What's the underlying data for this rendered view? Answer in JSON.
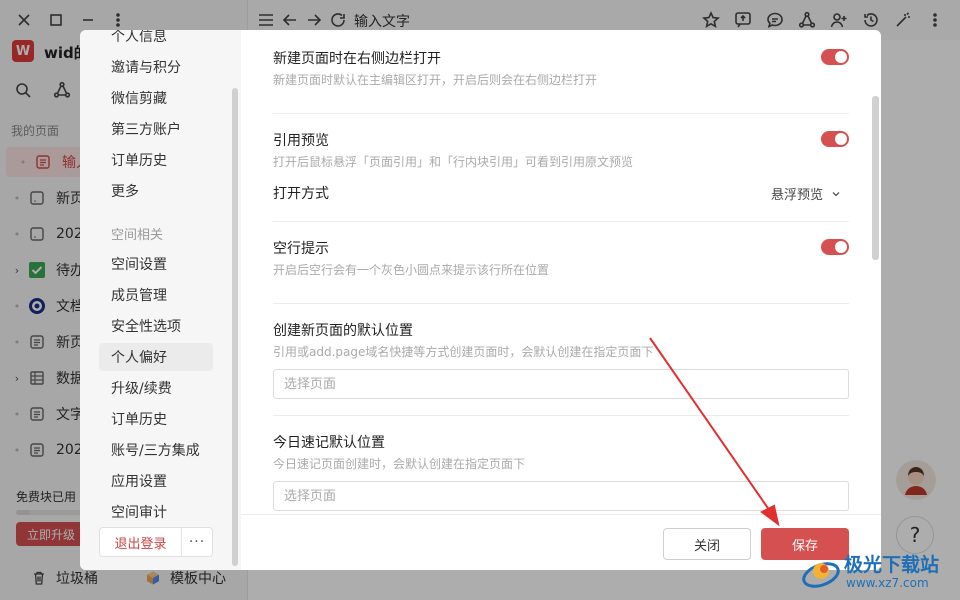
{
  "app": {
    "title": "输入文字",
    "workspace_badge": "W",
    "workspace_name": "wid的",
    "my_pages_label": "我的页面",
    "pages": [
      {
        "label": "输入",
        "icon": "doc-icon",
        "active": true
      },
      {
        "label": "新页",
        "icon": "blank-doc-icon"
      },
      {
        "label": "202",
        "icon": "blank-doc-icon"
      },
      {
        "label": "待办",
        "icon": "checkbox-icon"
      },
      {
        "label": "文档",
        "icon": "target-icon"
      },
      {
        "label": "新页",
        "icon": "doc-icon"
      },
      {
        "label": "数据",
        "icon": "table-icon"
      },
      {
        "label": "文字",
        "icon": "doc-icon"
      },
      {
        "label": "202",
        "icon": "doc-icon"
      }
    ],
    "quota_text": "免费块已用",
    "upgrade_label": "立即升级",
    "trash_label": "垃圾桶",
    "template_label": "模板中心",
    "help_label": "?"
  },
  "modal": {
    "nav_items_top": [
      "个人信息",
      "邀请与积分",
      "微信剪藏",
      "第三方账户",
      "订单历史",
      "更多"
    ],
    "section_space": "空间相关",
    "nav_items_space": [
      "空间设置",
      "成员管理",
      "安全性选项",
      "个人偏好",
      "升级/续费",
      "订单历史",
      "账号/三方集成",
      "应用设置",
      "空间审计"
    ],
    "selected_nav": "个人偏好",
    "logout_label": "退出登录",
    "more_label": "···",
    "settings": {
      "sidebar_open": {
        "title": "新建页面时在右侧边栏打开",
        "desc": "新建页面时默认在主编辑区打开，开启后则会在右侧边栏打开",
        "enabled": true
      },
      "ref_preview": {
        "title": "引用预览",
        "desc": "打开后鼠标悬浮「页面引用」和「行内块引用」可看到引用原文预览",
        "enabled": true,
        "open_mode_label": "打开方式",
        "open_mode_value": "悬浮预览"
      },
      "empty_line": {
        "title": "空行提示",
        "desc": "开启后空行会有一个灰色小圆点来提示该行所在位置",
        "enabled": true
      },
      "default_location": {
        "title": "创建新页面的默认位置",
        "desc": "引用或add.page域名快捷等方式创建页面时，会默认创建在指定页面下",
        "placeholder": "选择页面"
      },
      "quick_note_location": {
        "title": "今日速记默认位置",
        "desc": "今日速记页面创建时，会默认创建在指定页面下",
        "placeholder": "选择页面"
      }
    },
    "close_label": "关闭",
    "save_label": "保存"
  },
  "watermark": {
    "name": "极光下载站",
    "url": "www.xz7.com"
  },
  "colors": {
    "accent": "#d55050",
    "overlay": "rgba(0,0,0,0.32)",
    "arrow": "#e03030",
    "watermark": "#1f6fb8"
  }
}
